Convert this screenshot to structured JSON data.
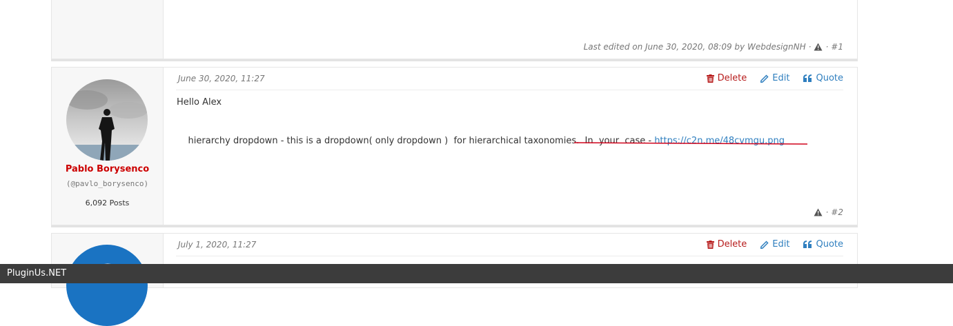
{
  "post1": {
    "edited_text": "Last edited on June 30, 2020, 08:09 by WebdesignNH",
    "sep": "·",
    "number": "#1"
  },
  "post2": {
    "date": "June 30, 2020, 11:27",
    "actions": {
      "delete": "Delete",
      "edit": "Edit",
      "quote": "Quote"
    },
    "author": {
      "name": "Pablo Borysenco",
      "handle": "(@pavlo_borysenco)",
      "posts": "6,092 Posts"
    },
    "greeting": "Hello Alex",
    "line_text": "hierarchy dropdown - this is a dropdown( only dropdown )  for hierarchical taxonomies.  In  your  case - ",
    "link": "https://c2n.me/48cvmgu.png",
    "sep": "·",
    "number": "#2"
  },
  "post3": {
    "date": "July 1, 2020, 11:27",
    "actions": {
      "delete": "Delete",
      "edit": "Edit",
      "quote": "Quote"
    }
  },
  "footer": {
    "brand": "PluginUs.NET"
  },
  "colors": {
    "delete": "#b71c1c",
    "link": "#2f7fbf",
    "username": "#cc0000",
    "underline": "#d0021b"
  }
}
